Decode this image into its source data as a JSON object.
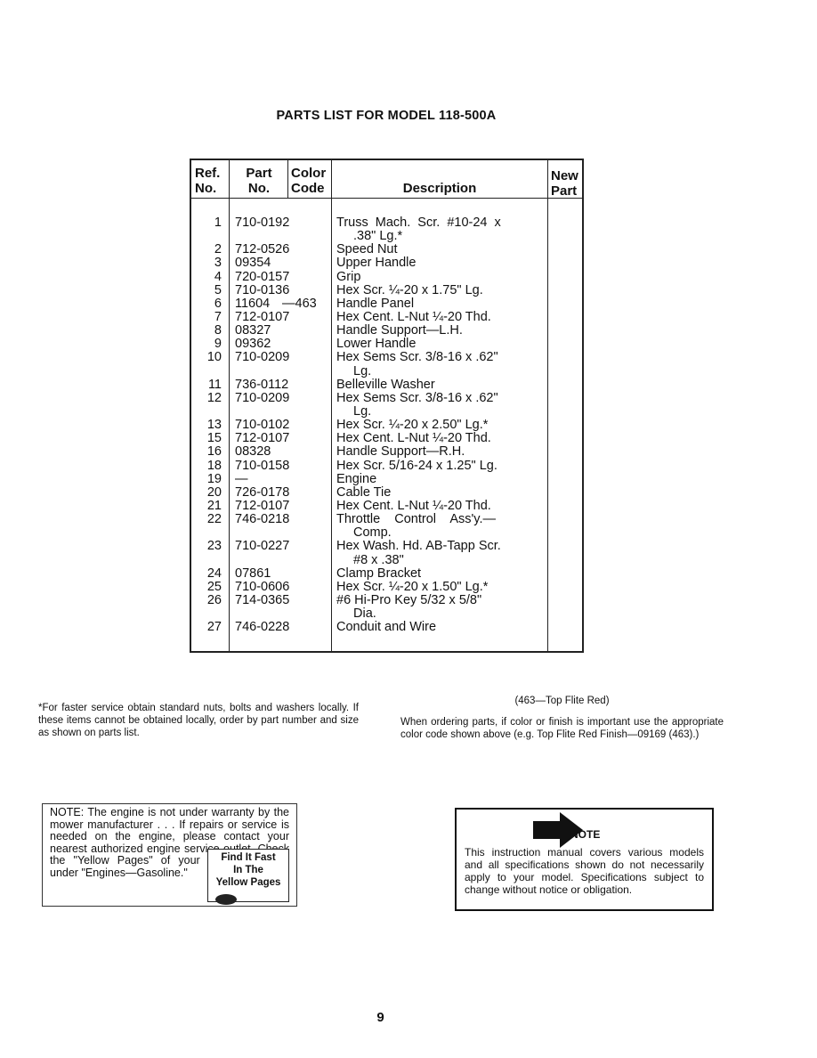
{
  "title": "PARTS LIST FOR MODEL 118-500A",
  "headers": {
    "ref1": "Ref.",
    "ref2": "No.",
    "part1": "Part",
    "part2": "No.",
    "color1": "Color",
    "color2": "Code",
    "desc": "Description",
    "new1": "New",
    "new2": "Part"
  },
  "rows": [
    {
      "ref": "1",
      "part": "710-0192",
      "color": "",
      "desc": "Truss  Mach.  Scr.  #10-24  x",
      "desc2": ".38\" Lg.*"
    },
    {
      "ref": "2",
      "part": "712-0526",
      "color": "",
      "desc": "Speed Nut"
    },
    {
      "ref": "3",
      "part": "09354",
      "color": "",
      "desc": "Upper Handle"
    },
    {
      "ref": "4",
      "part": "720-0157",
      "color": "",
      "desc": "Grip"
    },
    {
      "ref": "5",
      "part": "710-0136",
      "color": "",
      "desc": "Hex Scr. ¼-20 x 1.75\" Lg."
    },
    {
      "ref": "6",
      "part": "11604",
      "color": "—463",
      "desc": "Handle Panel"
    },
    {
      "ref": "7",
      "part": "712-0107",
      "color": "",
      "desc": "Hex Cent. L-Nut ¼-20 Thd."
    },
    {
      "ref": "8",
      "part": "08327",
      "color": "",
      "desc": "Handle Support—L.H."
    },
    {
      "ref": "9",
      "part": "09362",
      "color": "",
      "desc": "Lower Handle"
    },
    {
      "ref": "10",
      "part": "710-0209",
      "color": "",
      "desc": "Hex Sems Scr. 3/8-16 x .62\"",
      "desc2": "Lg."
    },
    {
      "ref": "11",
      "part": "736-0112",
      "color": "",
      "desc": "Belleville Washer"
    },
    {
      "ref": "12",
      "part": "710-0209",
      "color": "",
      "desc": "Hex Sems Scr. 3/8-16 x .62\"",
      "desc2": "Lg."
    },
    {
      "ref": "13",
      "part": "710-0102",
      "color": "",
      "desc": "Hex Scr. ¼-20 x 2.50\" Lg.*"
    },
    {
      "ref": "15",
      "part": "712-0107",
      "color": "",
      "desc": "Hex Cent. L-Nut ¼-20 Thd."
    },
    {
      "ref": "16",
      "part": "08328",
      "color": "",
      "desc": "Handle Support—R.H."
    },
    {
      "ref": "18",
      "part": "710-0158",
      "color": "",
      "desc": "Hex Scr. 5/16-24 x 1.25\" Lg."
    },
    {
      "ref": "19",
      "part": "  —",
      "color": "",
      "desc": "Engine"
    },
    {
      "ref": "20",
      "part": "726-0178",
      "color": "",
      "desc": "Cable Tie"
    },
    {
      "ref": "21",
      "part": "712-0107",
      "color": "",
      "desc": "Hex Cent. L-Nut ¼-20 Thd."
    },
    {
      "ref": "22",
      "part": "746-0218",
      "color": "",
      "desc": "Throttle    Control    Ass'y.—",
      "desc2": "Comp."
    },
    {
      "ref": "23",
      "part": "710-0227",
      "color": "",
      "desc": "Hex Wash. Hd. AB-Tapp Scr.",
      "desc2": "#8 x .38\""
    },
    {
      "ref": "24",
      "part": "07861",
      "color": "",
      "desc": "Clamp Bracket"
    },
    {
      "ref": "25",
      "part": "710-0606",
      "color": "",
      "desc": "Hex Scr. ¼-20 x 1.50\" Lg.*"
    },
    {
      "ref": "26",
      "part": "714-0365",
      "color": "",
      "desc": "#6 Hi-Pro Key 5/32 x 5/8\"",
      "desc2": "Dia."
    },
    {
      "ref": "27",
      "part": "746-0228",
      "color": "",
      "desc": "Conduit and Wire"
    }
  ],
  "footnote": "*For faster service obtain standard nuts, bolts and washers locally. If these items cannot be obtained locally, order by part number and size as shown on parts list.",
  "color_legend": "(463—Top Flite Red)",
  "ordering_note": "When ordering parts, if color or finish is important use the appropriate color code shown above (e.g. Top Flite Red Finish—09169 (463).)",
  "engine_note": "NOTE: The engine is not under warranty by the mower manufacturer . . . If repairs or service is needed on the engine, please contact your nearest authorized engine service outlet. Check the \"Yellow Pages\" of your telephone book under \"Engines—Gasoline.\"",
  "yellow_pages_logo": [
    "Find It Fast",
    "In The",
    "Yellow Pages"
  ],
  "note_box": {
    "heading": "NOTE",
    "text": "This instruction manual covers various models and all specifications shown do not necessarily apply to your model. Specifications subject to change without notice or obligation."
  },
  "page_number": "9"
}
